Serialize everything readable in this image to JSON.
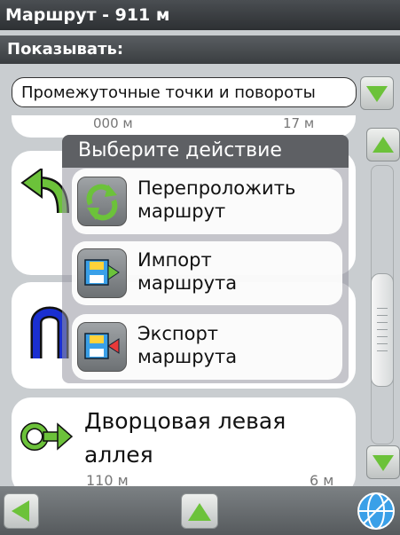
{
  "header": {
    "title": "Маршрут - 911 м",
    "show_label": "Показывать:"
  },
  "filter": {
    "selected": "Промежуточные точки и повороты"
  },
  "list": [
    {
      "distance": "000 м",
      "remaining": "17 м"
    },
    {
      "name": "Дворцовая левая аллея",
      "distance": "110 м",
      "remaining": "6 м"
    }
  ],
  "dialog": {
    "title": "Выберите действие",
    "actions": [
      {
        "label": "Перепроложить\nмаршрут"
      },
      {
        "label": "Импорт\nмаршрута"
      },
      {
        "label": "Экспорт\nмаршрута"
      }
    ]
  },
  "colors": {
    "accent_green": "#6cc23a",
    "maneuver_blue": "#1a2fd1",
    "titlebar": "#2d3033"
  }
}
